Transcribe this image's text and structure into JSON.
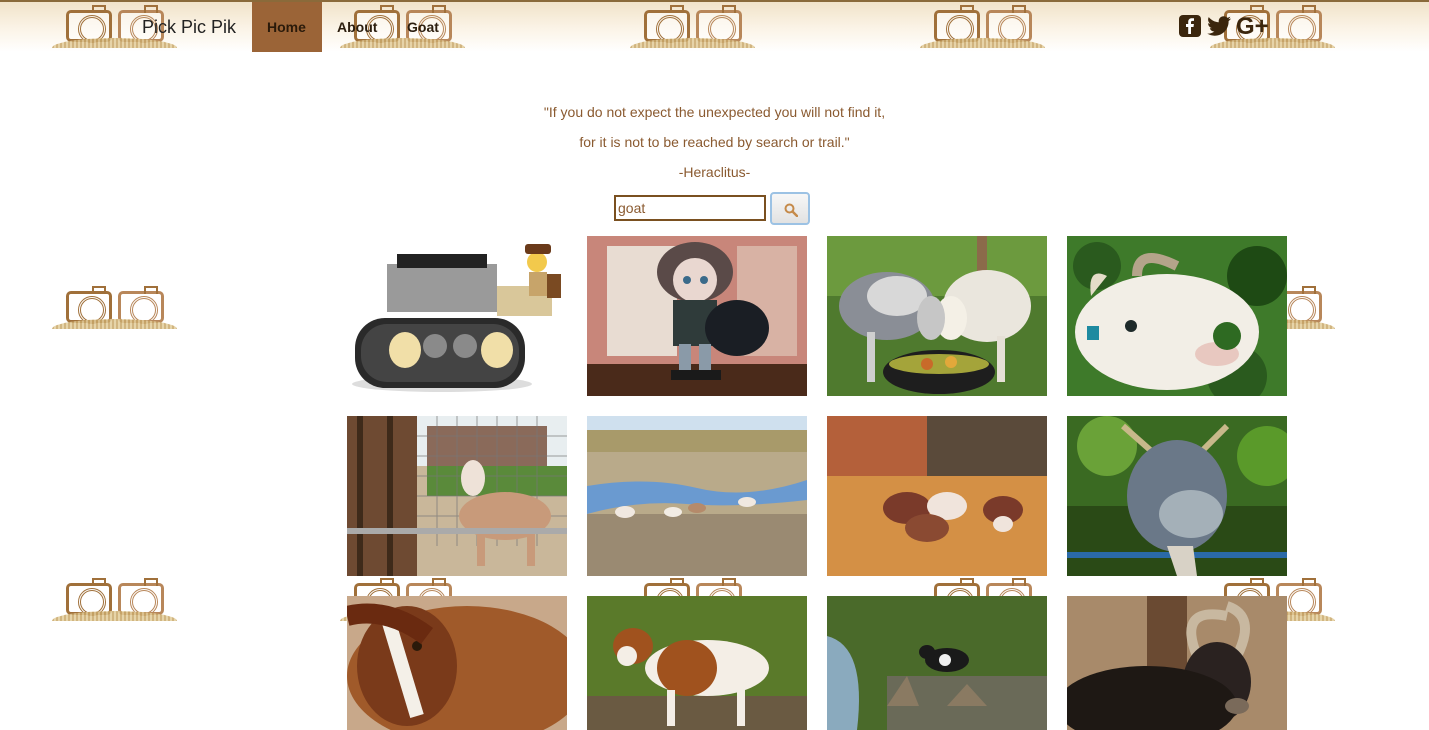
{
  "navbar": {
    "brand": "Pick Pic Pik",
    "items": [
      {
        "label": "Home",
        "active": true
      },
      {
        "label": "About",
        "active": false
      },
      {
        "label": "Goat",
        "active": false
      }
    ],
    "social_icons": [
      "facebook-icon",
      "twitter-icon",
      "google-plus-icon"
    ],
    "social_glyphs": {
      "google_plus": "G+"
    }
  },
  "quote": {
    "line1": "\"If you do not expect the unexpected you will not find it,",
    "line2": "for it is not to be reached by search or trail.\"",
    "author": "-Heraclitus-"
  },
  "search": {
    "value": "goat",
    "button_icon": "search-icon"
  },
  "colors": {
    "accent": "#9b6437",
    "text_brown": "#8a5a30",
    "nav_text": "#2b1d0e"
  },
  "results": [
    {
      "subject": "lego-tractor"
    },
    {
      "subject": "doll"
    },
    {
      "subject": "two-goats-eating"
    },
    {
      "subject": "goat-eating-leaves"
    },
    {
      "subject": "goat-behind-fence"
    },
    {
      "subject": "goats-by-water"
    },
    {
      "subject": "baby-goats-in-hay"
    },
    {
      "subject": "goat-portrait"
    },
    {
      "subject": "brown-goat-closeup"
    },
    {
      "subject": "brown-white-kid"
    },
    {
      "subject": "black-goat-on-rocks"
    },
    {
      "subject": "horned-black-goat"
    }
  ]
}
